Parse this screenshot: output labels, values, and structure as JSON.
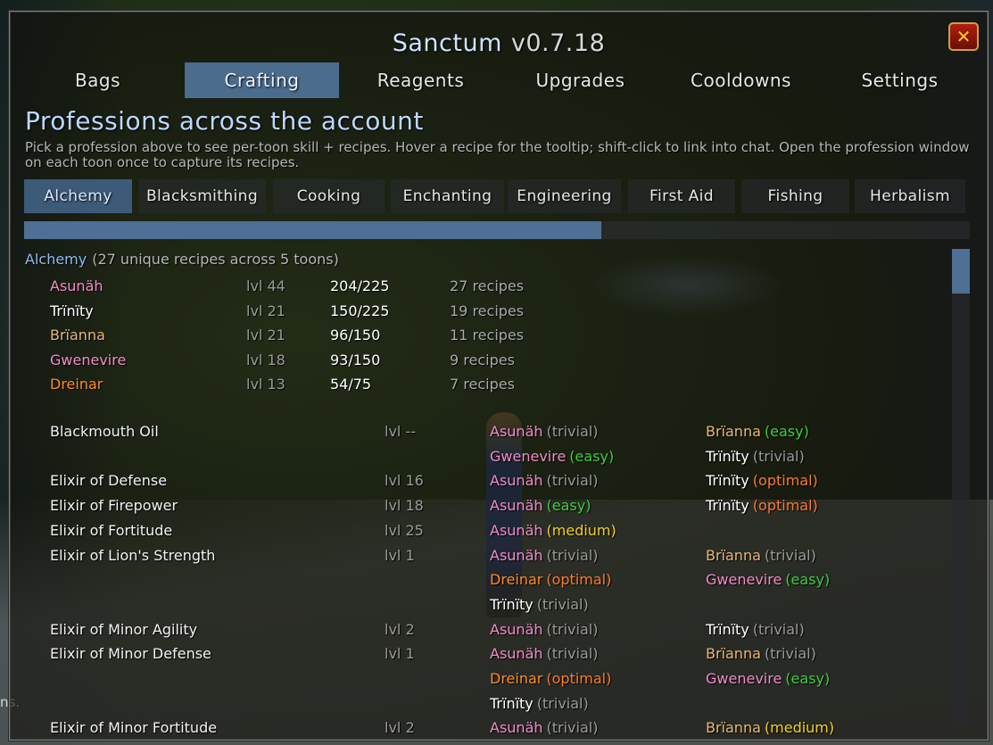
{
  "window": {
    "title": "Sanctum",
    "version": "v0.7.18"
  },
  "tabs": [
    {
      "label": "Bags",
      "active": false
    },
    {
      "label": "Crafting",
      "active": true
    },
    {
      "label": "Reagents",
      "active": false
    },
    {
      "label": "Upgrades",
      "active": false
    },
    {
      "label": "Cooldowns",
      "active": false
    },
    {
      "label": "Settings",
      "active": false
    }
  ],
  "heading": "Professions across the account",
  "description": "Pick a profession above to see per-toon skill + recipes. Hover a recipe for the tooltip; shift-click to link into chat. Open the profession window on each toon once to capture its recipes.",
  "professions": [
    {
      "label": "Alchemy",
      "active": true
    },
    {
      "label": "Blacksmithing",
      "active": false
    },
    {
      "label": "Cooking",
      "active": false
    },
    {
      "label": "Enchanting",
      "active": false
    },
    {
      "label": "Engineering",
      "active": false
    },
    {
      "label": "First Aid",
      "active": false
    },
    {
      "label": "Fishing",
      "active": false
    },
    {
      "label": "Herbalism",
      "active": false
    }
  ],
  "profession_scroll_fraction": 0.61,
  "section": {
    "title": "Alchemy",
    "note": "(27 unique recipes across 5 toons)"
  },
  "toons": [
    {
      "name": "Asunäh",
      "level": "lvl 44",
      "skill": "204/225",
      "recipes": "27 recipes",
      "color": "#f28cc8"
    },
    {
      "name": "Trïnïty",
      "level": "lvl 21",
      "skill": "150/225",
      "recipes": "19 recipes",
      "color": "#ffffff"
    },
    {
      "name": "Brïanna",
      "level": "lvl 21",
      "skill": "96/150",
      "recipes": "11 recipes",
      "color": "#e8b878"
    },
    {
      "name": "Gwenevire",
      "level": "lvl 18",
      "skill": "93/150",
      "recipes": "9 recipes",
      "color": "#f28cc8"
    },
    {
      "name": "Dreinar",
      "level": "lvl 13",
      "skill": "54/75",
      "recipes": "7 recipes",
      "color": "#ff8c2a"
    }
  ],
  "difficulty_colors": {
    "trivial": "#9a9a9a",
    "easy": "#3fcf3f",
    "medium": "#f2d21a",
    "optimal": "#ff7b2e"
  },
  "recipes": [
    {
      "name": "Blackmouth Oil",
      "level": "lvl --",
      "row": 0,
      "c1": {
        "toon": "Asunäh",
        "color": "#f28cc8",
        "diff": "(trivial)",
        "dcolor": "#9a9a9a"
      },
      "c2": {
        "toon": "Brïanna",
        "color": "#e8b878",
        "diff": "(easy)",
        "dcolor": "#3fcf3f"
      }
    },
    {
      "name": "",
      "level": "",
      "row": 1,
      "c1": {
        "toon": "Gwenevire",
        "color": "#f28cc8",
        "diff": "(easy)",
        "dcolor": "#3fcf3f"
      },
      "c2": {
        "toon": "Trïnïty",
        "color": "#ffffff",
        "diff": "(trivial)",
        "dcolor": "#9a9a9a"
      }
    },
    {
      "name": "Elixir of Defense",
      "level": "lvl 16",
      "row": 2,
      "c1": {
        "toon": "Asunäh",
        "color": "#f28cc8",
        "diff": "(trivial)",
        "dcolor": "#9a9a9a"
      },
      "c2": {
        "toon": "Trïnïty",
        "color": "#ffffff",
        "diff": "(optimal)",
        "dcolor": "#ff7b2e"
      }
    },
    {
      "name": "Elixir of Firepower",
      "level": "lvl 18",
      "row": 3,
      "c1": {
        "toon": "Asunäh",
        "color": "#f28cc8",
        "diff": "(easy)",
        "dcolor": "#3fcf3f"
      },
      "c2": {
        "toon": "Trïnïty",
        "color": "#ffffff",
        "diff": "(optimal)",
        "dcolor": "#ff7b2e"
      }
    },
    {
      "name": "Elixir of Fortitude",
      "level": "lvl 25",
      "row": 4,
      "c1": {
        "toon": "Asunäh",
        "color": "#f28cc8",
        "diff": "(medium)",
        "dcolor": "#f2d21a"
      },
      "c2": null
    },
    {
      "name": "Elixir of Lion's Strength",
      "level": "lvl 1",
      "row": 5,
      "c1": {
        "toon": "Asunäh",
        "color": "#f28cc8",
        "diff": "(trivial)",
        "dcolor": "#9a9a9a"
      },
      "c2": {
        "toon": "Brïanna",
        "color": "#e8b878",
        "diff": "(trivial)",
        "dcolor": "#9a9a9a"
      }
    },
    {
      "name": "",
      "level": "",
      "row": 6,
      "c1": {
        "toon": "Dreinar",
        "color": "#ff8c2a",
        "diff": "(optimal)",
        "dcolor": "#ff7b2e"
      },
      "c2": {
        "toon": "Gwenevire",
        "color": "#f28cc8",
        "diff": "(easy)",
        "dcolor": "#3fcf3f"
      }
    },
    {
      "name": "",
      "level": "",
      "row": 7,
      "c1": {
        "toon": "Trïnïty",
        "color": "#ffffff",
        "diff": "(trivial)",
        "dcolor": "#9a9a9a"
      },
      "c2": null
    },
    {
      "name": "Elixir of Minor Agility",
      "level": "lvl 2",
      "row": 8,
      "c1": {
        "toon": "Asunäh",
        "color": "#f28cc8",
        "diff": "(trivial)",
        "dcolor": "#9a9a9a"
      },
      "c2": {
        "toon": "Trïnïty",
        "color": "#ffffff",
        "diff": "(trivial)",
        "dcolor": "#9a9a9a"
      }
    },
    {
      "name": "Elixir of Minor Defense",
      "level": "lvl 1",
      "row": 9,
      "c1": {
        "toon": "Asunäh",
        "color": "#f28cc8",
        "diff": "(trivial)",
        "dcolor": "#9a9a9a"
      },
      "c2": {
        "toon": "Brïanna",
        "color": "#e8b878",
        "diff": "(trivial)",
        "dcolor": "#9a9a9a"
      }
    },
    {
      "name": "",
      "level": "",
      "row": 10,
      "c1": {
        "toon": "Dreinar",
        "color": "#ff8c2a",
        "diff": "(optimal)",
        "dcolor": "#ff7b2e"
      },
      "c2": {
        "toon": "Gwenevire",
        "color": "#f28cc8",
        "diff": "(easy)",
        "dcolor": "#3fcf3f"
      }
    },
    {
      "name": "",
      "level": "",
      "row": 11,
      "c1": {
        "toon": "Trïnïty",
        "color": "#ffffff",
        "diff": "(trivial)",
        "dcolor": "#9a9a9a"
      },
      "c2": null
    },
    {
      "name": "Elixir of Minor Fortitude",
      "level": "lvl 2",
      "row": 12,
      "c1": {
        "toon": "Asunäh",
        "color": "#f28cc8",
        "diff": "(trivial)",
        "dcolor": "#9a9a9a"
      },
      "c2": {
        "toon": "Brïanna",
        "color": "#e8b878",
        "diff": "(medium)",
        "dcolor": "#f2d21a"
      }
    }
  ],
  "background_text": "ns."
}
